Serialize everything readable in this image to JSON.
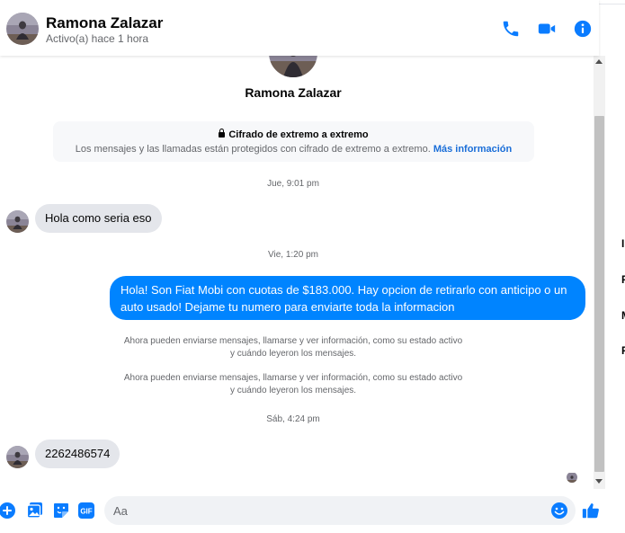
{
  "header": {
    "name": "Ramona Zalazar",
    "status": "Activo(a) hace 1 hora",
    "icons": [
      "phone-icon",
      "video-camera-icon",
      "info-icon"
    ]
  },
  "profile": {
    "name": "Ramona Zalazar"
  },
  "encryption": {
    "title": "Cifrado de extremo a extremo",
    "description": "Los mensajes y las llamadas están protegidos con cifrado de extremo a extremo.",
    "link": "Más información"
  },
  "timestamps": [
    "Jue, 9:01 pm",
    "Vie, 1:20 pm",
    "Sáb, 4:24 pm"
  ],
  "messages": [
    {
      "direction": "incoming",
      "text": "Hola como seria eso"
    },
    {
      "direction": "outgoing",
      "text": "Hola! Son Fiat Mobi con cuotas de $183.000. Hay opcion de retirarlo con anticipo o un auto usado! Dejame tu numero para enviarte toda la informacion"
    },
    {
      "direction": "incoming",
      "text": "2262486574"
    }
  ],
  "system_notes": [
    {
      "line1": "Ahora pueden enviarse mensajes, llamarse y ver información, como su estado activo",
      "line2": "y cuándo leyeron los mensajes."
    },
    {
      "line1": "Ahora pueden enviarse mensajes, llamarse y ver información, como su estado activo",
      "line2": "y cuándo leyeron los mensajes."
    }
  ],
  "composer": {
    "placeholder": "Aa",
    "gif_label": "GIF",
    "icons": [
      "plus-icon",
      "image-icon",
      "sticker-icon",
      "gif-icon",
      "emoji-icon",
      "thumbs-up-icon"
    ]
  },
  "sidebar_letters": [
    "I",
    "F",
    "M",
    "F"
  ],
  "colors": {
    "accent": "#0084ff",
    "icon_blue": "#0a7cff",
    "incoming_bubble": "#e4e6eb",
    "secondary_text": "#65676b"
  }
}
